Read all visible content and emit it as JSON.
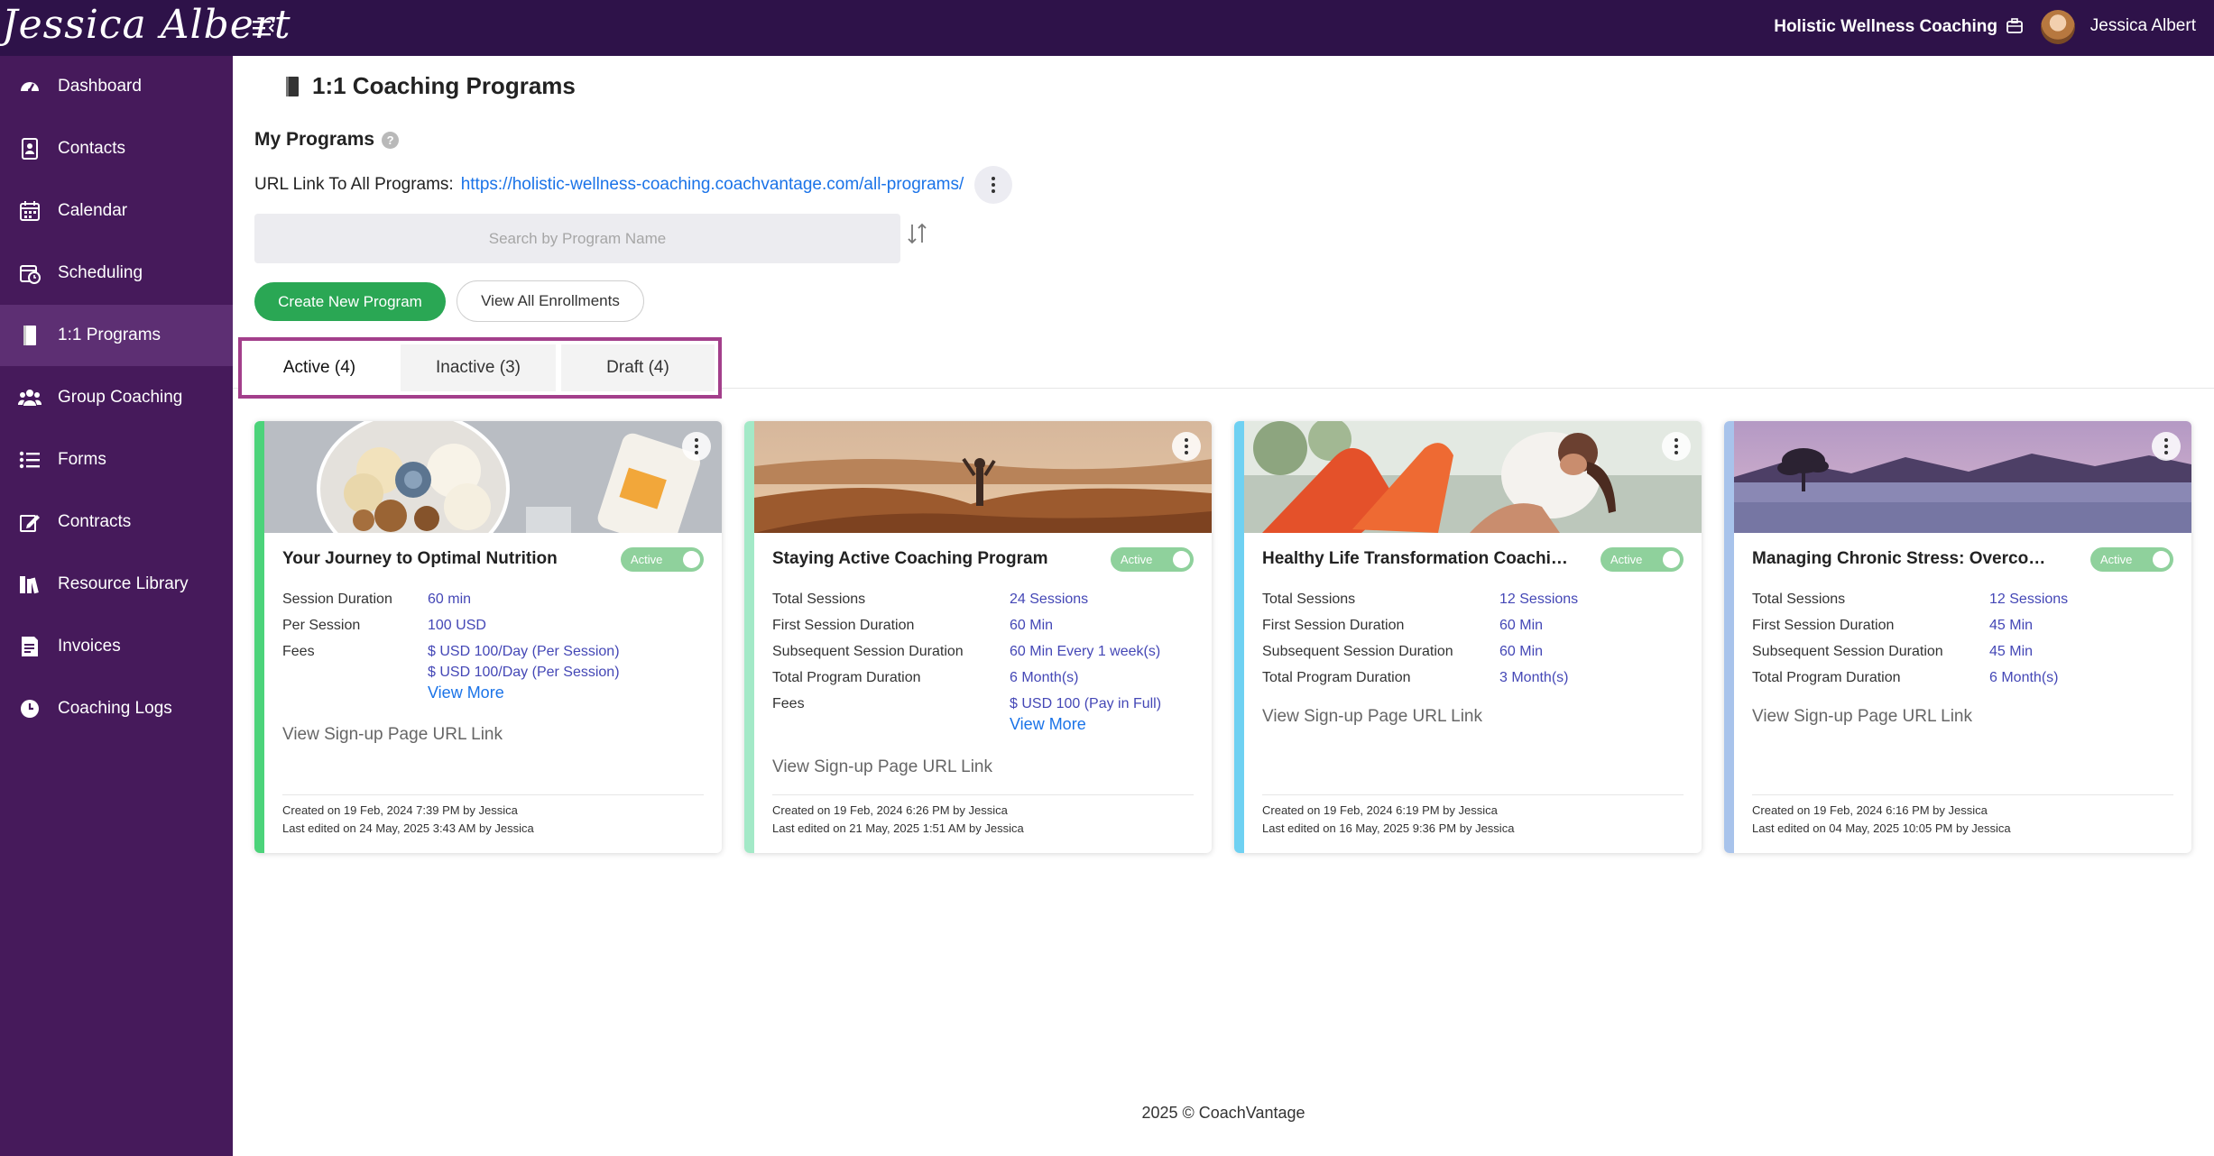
{
  "header": {
    "logo_text": "Jessica Albert",
    "brand": "Holistic Wellness Coaching",
    "user_name": "Jessica Albert",
    "bg_color": "#2e1249"
  },
  "sidebar": {
    "bg_color": "#461a5b",
    "items": [
      {
        "label": "Dashboard",
        "icon": "speedometer-icon"
      },
      {
        "label": "Contacts",
        "icon": "contact-book-icon"
      },
      {
        "label": "Calendar",
        "icon": "calendar-icon"
      },
      {
        "label": "Scheduling",
        "icon": "calendar-clock-icon"
      },
      {
        "label": "1:1 Programs",
        "icon": "book-icon",
        "active": true
      },
      {
        "label": "Group Coaching",
        "icon": "group-icon"
      },
      {
        "label": "Forms",
        "icon": "list-icon"
      },
      {
        "label": "Contracts",
        "icon": "signature-icon"
      },
      {
        "label": "Resource Library",
        "icon": "library-icon"
      },
      {
        "label": "Invoices",
        "icon": "invoice-icon"
      },
      {
        "label": "Coaching Logs",
        "icon": "clock-icon"
      }
    ]
  },
  "page": {
    "title": "1:1 Coaching Programs",
    "my_programs": "My Programs",
    "url_label": "URL Link To All Programs:",
    "url": "https://holistic-wellness-coaching.coachvantage.com/all-programs/",
    "search_placeholder": "Search by Program Name",
    "create_button": "Create New Program",
    "enrollments_button": "View All Enrollments"
  },
  "tabs": [
    {
      "label": "Active (4)",
      "active": true
    },
    {
      "label": "Inactive (3)"
    },
    {
      "label": "Draft (4)"
    }
  ],
  "cards": [
    {
      "title": "Your Journey to Optimal Nutrition",
      "status": "Active",
      "accent": "#4cd37a",
      "image": "nutrition bowl photo",
      "rows": [
        {
          "k": "Session Duration",
          "v": [
            "60 min"
          ]
        },
        {
          "k": "Per Session",
          "v": [
            "100 USD"
          ]
        },
        {
          "k": "Fees",
          "v": [
            "$ USD 100/Day (Per Session)",
            "$ USD 100/Day (Per Session)"
          ]
        }
      ],
      "view_more": "View More",
      "signup": "View Sign-up Page URL Link",
      "created": "Created on 19 Feb, 2024 7:39 PM by Jessica",
      "edited": "Last edited on 24 May, 2025 3:43 AM by Jessica"
    },
    {
      "title": "Staying Active Coaching Program",
      "status": "Active",
      "accent": "#a3e9c7",
      "image": "desert dunes photo",
      "rows": [
        {
          "k": "Total Sessions",
          "v": [
            "24 Sessions"
          ]
        },
        {
          "k": "First Session Duration",
          "v": [
            "60 Min"
          ]
        },
        {
          "k": "Subsequent Session Duration",
          "v": [
            "60 Min Every 1 week(s)"
          ]
        },
        {
          "k": "Total Program Duration",
          "v": [
            "6 Month(s)"
          ]
        },
        {
          "k": "Fees",
          "v": [
            "$ USD 100 (Pay in Full)"
          ]
        }
      ],
      "view_more": "View More",
      "signup": "View Sign-up Page URL Link",
      "created": "Created on 19 Feb, 2024 6:26 PM by Jessica",
      "edited": "Last edited on 21 May, 2025 1:51 AM by Jessica"
    },
    {
      "title": "Healthy Life Transformation Coaching Program",
      "status": "Active",
      "accent": "#6fd1f2",
      "image": "workout photo",
      "rows": [
        {
          "k": "Total Sessions",
          "v": [
            "12 Sessions"
          ]
        },
        {
          "k": "First Session Duration",
          "v": [
            "60 Min"
          ]
        },
        {
          "k": "Subsequent Session Duration",
          "v": [
            "60 Min"
          ]
        },
        {
          "k": "Total Program Duration",
          "v": [
            "3 Month(s)"
          ]
        }
      ],
      "signup": "View Sign-up Page URL Link",
      "created": "Created on 19 Feb, 2024 6:19 PM by Jessica",
      "edited": "Last edited on 16 May, 2025 9:36 PM by Jessica"
    },
    {
      "title": "Managing Chronic Stress: Overcome Anxiety",
      "status": "Active",
      "accent": "#a8c3eb",
      "image": "lake tree photo",
      "rows": [
        {
          "k": "Total Sessions",
          "v": [
            "12 Sessions"
          ]
        },
        {
          "k": "First Session Duration",
          "v": [
            "45 Min"
          ]
        },
        {
          "k": "Subsequent Session Duration",
          "v": [
            "45 Min"
          ]
        },
        {
          "k": "Total Program Duration",
          "v": [
            "6 Month(s)"
          ]
        }
      ],
      "signup": "View Sign-up Page URL Link",
      "created": "Created on 19 Feb, 2024 6:16 PM by Jessica",
      "edited": "Last edited on 04 May, 2025 10:05 PM by Jessica"
    }
  ],
  "footer": "2025 © CoachVantage",
  "help_button": "?"
}
